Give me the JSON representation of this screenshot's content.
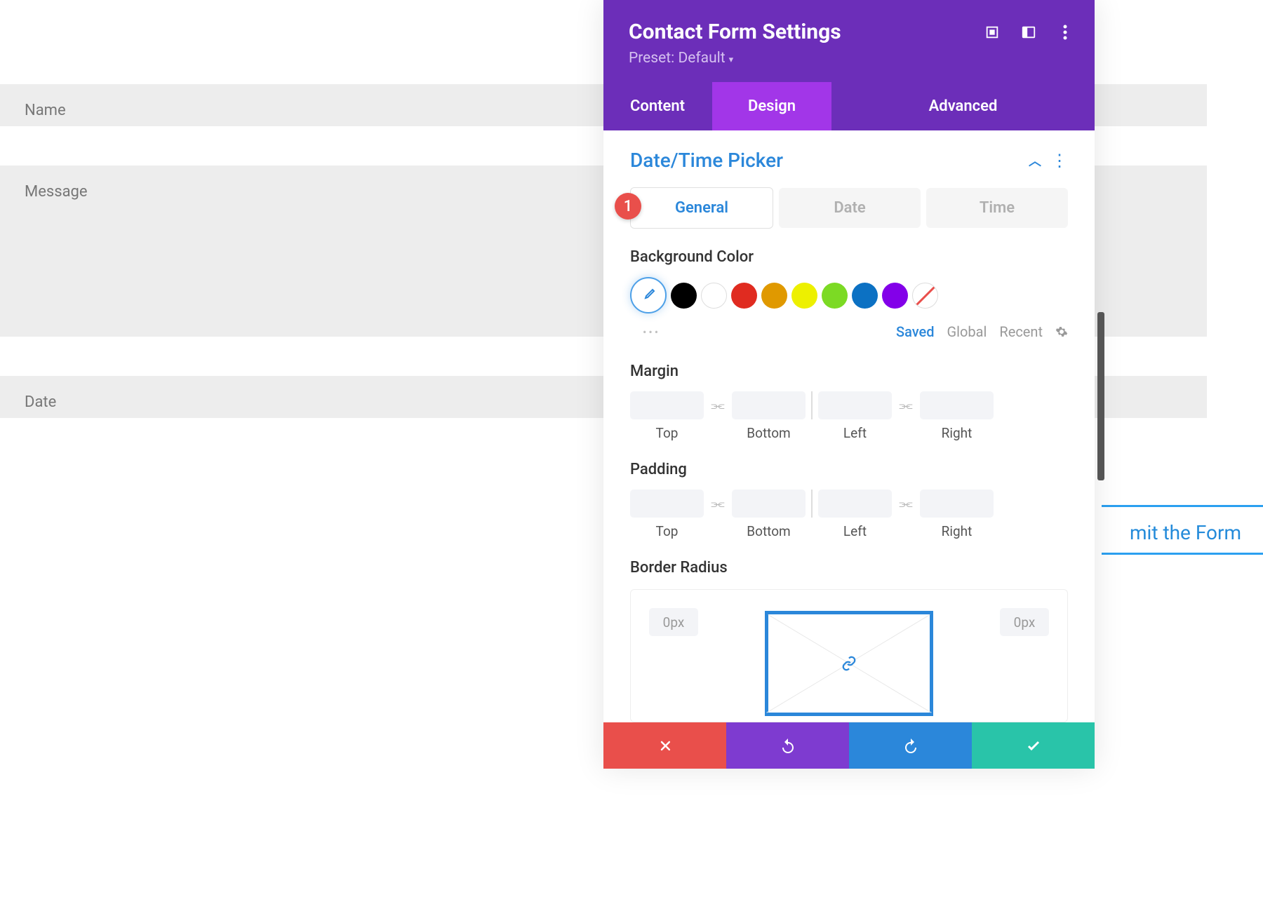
{
  "form": {
    "name_placeholder": "Name",
    "message_placeholder": "Message",
    "date_placeholder": "Date",
    "submit_text": "mit the Form"
  },
  "panel": {
    "title": "Contact Form Settings",
    "preset": "Preset: Default",
    "tabs": {
      "content": "Content",
      "design": "Design",
      "advanced": "Advanced"
    },
    "section_title": "Date/Time Picker",
    "badge": "1",
    "subtabs": {
      "general": "General",
      "date": "Date",
      "time": "Time"
    },
    "bg_color_label": "Background Color",
    "palette_tabs": {
      "saved": "Saved",
      "global": "Global",
      "recent": "Recent"
    },
    "margin_label": "Margin",
    "padding_label": "Padding",
    "spacing": {
      "top": "Top",
      "bottom": "Bottom",
      "left": "Left",
      "right": "Right"
    },
    "border_radius_label": "Border Radius",
    "corner_value": "0px",
    "colors": {
      "picker": "#2b87da",
      "black": "#000000",
      "white": "#ffffff",
      "red": "#e02b20",
      "orange": "#e09900",
      "yellow": "#edf000",
      "green": "#7cda24",
      "blue": "#0c71c3",
      "purple": "#8300e9"
    }
  }
}
